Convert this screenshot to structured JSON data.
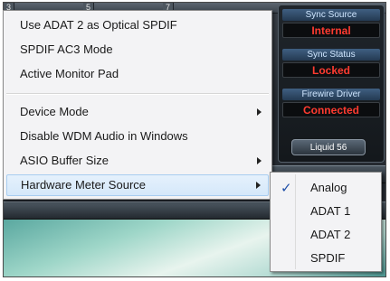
{
  "app": {
    "channel_numbers": [
      "3",
      "5",
      "7"
    ],
    "sync_source": {
      "label": "Sync Source",
      "value": "Internal"
    },
    "sync_status": {
      "label": "Sync Status",
      "value": "Locked"
    },
    "firewire_driver": {
      "label": "Firewire Driver",
      "value": "Connected"
    },
    "device_name": "Liquid 56"
  },
  "context_menu": {
    "items": [
      {
        "label": "Use ADAT 2 as Optical SPDIF"
      },
      {
        "label": "SPDIF AC3 Mode"
      },
      {
        "label": "Active Monitor Pad"
      },
      {
        "label": "Device Mode",
        "has_submenu": true
      },
      {
        "label": "Disable WDM Audio in Windows"
      },
      {
        "label": "ASIO Buffer Size",
        "has_submenu": true
      },
      {
        "label": "Hardware Meter Source",
        "has_submenu": true,
        "highlighted": true
      }
    ]
  },
  "submenu": {
    "items": [
      {
        "label": "Analog",
        "checked": true
      },
      {
        "label": "ADAT 1",
        "checked": false
      },
      {
        "label": "ADAT 2",
        "checked": false
      },
      {
        "label": "SPDIF",
        "checked": false
      }
    ],
    "check_glyph": "✓"
  },
  "colors": {
    "status_value": "#ff3b30",
    "highlight_border": "#a8cdf0",
    "check": "#1f4fa8"
  }
}
